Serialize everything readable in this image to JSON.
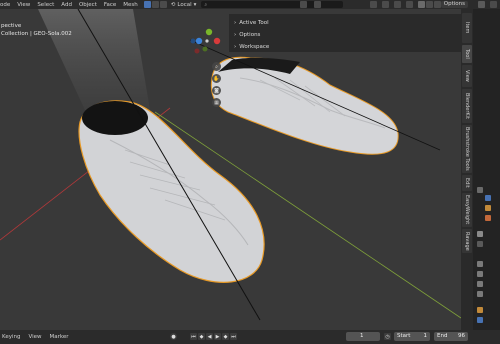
{
  "topbar": {
    "menu": [
      "ode",
      "View",
      "Select",
      "Add",
      "Object",
      "Face",
      "Mesh"
    ],
    "orientation": "Local",
    "options_label": "Options"
  },
  "viewport": {
    "view_name": "pective",
    "collection_label": "Collection | GEO-Sola.002"
  },
  "panel": {
    "rows": [
      "Active Tool",
      "Options",
      "Workspace"
    ]
  },
  "sidebar_tabs": [
    "Item",
    "Tool",
    "View",
    "BlenderKit",
    "Brushstroke Tools",
    "Edit",
    "EasyWeight",
    "Ravage"
  ],
  "timeline": {
    "menu": [
      "Keying",
      "View",
      "Marker"
    ],
    "current_frame": "1",
    "start_label": "Start",
    "start_value": "1",
    "end_label": "End",
    "end_value": "96"
  },
  "colors": {
    "selection_outline": "#f4a02a",
    "active_button": "#4772b3",
    "x_axis": "#b0383a",
    "y_axis": "#7fa13a"
  },
  "icons": {
    "gizmo_zoom": "magnifier-icon",
    "gizmo_pan": "hand-icon",
    "gizmo_camera": "camera-icon",
    "gizmo_grid": "grid-icon"
  }
}
